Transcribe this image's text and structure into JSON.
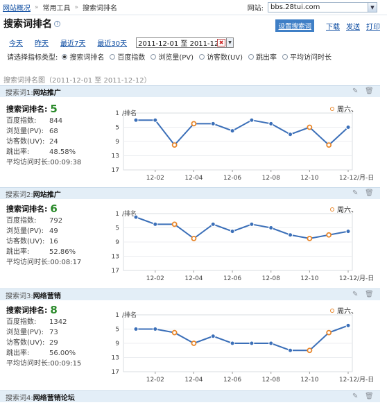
{
  "breadcrumb": {
    "home": "网站概况",
    "tools": "常用工具",
    "current": "搜索词排名"
  },
  "site": {
    "label": "网站:",
    "value": "bbs.28tui.com"
  },
  "page_title": "搜索词排名",
  "actions": {
    "settings": "设置搜索词",
    "download": "下载",
    "send": "发送",
    "print": "打印"
  },
  "date_links": [
    "今天",
    "昨天",
    "最近7天",
    "最近30天"
  ],
  "date_range": "2011-12-01 至 2011-12-12",
  "metric_select": {
    "label": "请选择指标类型:",
    "options": [
      "搜索词排名",
      "百度指数",
      "浏览量(PV)",
      "访客数(UV)",
      "跳出率",
      "平均访问时长"
    ],
    "selected": 0
  },
  "section_title": "搜索词排名图（2011-12-01 至 2011-12-12）",
  "stat_labels": {
    "rank": "搜索词排名:",
    "baidu": "百度指数:",
    "pv": "浏览量(PV):",
    "uv": "访客数(UV):",
    "bounce": "跳出率:",
    "avgtime": "平均访问时长:"
  },
  "keywords": [
    {
      "label": "搜索词1:",
      "name": "网站推广",
      "rank": "5",
      "baidu": "844",
      "pv": "68",
      "uv": "24",
      "bounce": "48.58%",
      "avgtime": "00:09:38"
    },
    {
      "label": "搜索词2:",
      "name": "网站推广",
      "rank": "6",
      "baidu": "792",
      "pv": "49",
      "uv": "16",
      "bounce": "52.86%",
      "avgtime": "00:08:17"
    },
    {
      "label": "搜索词3:",
      "name": "网络营销",
      "rank": "8",
      "baidu": "1342",
      "pv": "73",
      "uv": "29",
      "bounce": "56.00%",
      "avgtime": "00:09:15"
    },
    {
      "label": "搜索词4:",
      "name": "网络营销论坛"
    }
  ],
  "icons": {
    "edit": "pencil-icon",
    "delete": "trash-icon",
    "help": "question-icon",
    "dropdown": "chevron-down-icon"
  },
  "colors": {
    "line": "#3b6fb8",
    "weekend": "#e8862a",
    "rank_value": "#2a8a2a",
    "header_bg": "#e3eef7",
    "button": "#3f7fc6"
  },
  "chart_data": [
    {
      "type": "line",
      "legend": "周六、",
      "ylabel": "/排名",
      "xlabel": "/月-日",
      "y_ticks": [
        "1",
        "5",
        "9",
        "13",
        "17"
      ],
      "ylim": [
        17,
        1
      ],
      "x_ticks": [
        "12-02",
        "12-04",
        "12-06",
        "12-08",
        "12-10",
        "12-12"
      ],
      "x": [
        "12-01",
        "12-02",
        "12-03",
        "12-04",
        "12-05",
        "12-06",
        "12-07",
        "12-08",
        "12-09",
        "12-10",
        "12-11",
        "12-12"
      ],
      "values": [
        3,
        3,
        10,
        4,
        4,
        6,
        3,
        4,
        7,
        5,
        10,
        5
      ],
      "weekend": [
        false,
        false,
        true,
        true,
        false,
        false,
        false,
        false,
        false,
        true,
        true,
        false
      ]
    },
    {
      "type": "line",
      "legend": "周六、",
      "ylabel": "/排名",
      "xlabel": "/月-日",
      "y_ticks": [
        "1",
        "5",
        "9",
        "13",
        "17"
      ],
      "ylim": [
        17,
        1
      ],
      "x_ticks": [
        "12-02",
        "12-04",
        "12-06",
        "12-08",
        "12-10",
        "12-12"
      ],
      "x": [
        "12-01",
        "12-02",
        "12-03",
        "12-04",
        "12-05",
        "12-06",
        "12-07",
        "12-08",
        "12-09",
        "12-10",
        "12-11",
        "12-12"
      ],
      "values": [
        2,
        4,
        4,
        8,
        4,
        6,
        4,
        5,
        7,
        8,
        7,
        6
      ],
      "weekend": [
        false,
        false,
        true,
        true,
        false,
        false,
        false,
        false,
        false,
        true,
        true,
        false
      ]
    },
    {
      "type": "line",
      "legend": "周六、",
      "ylabel": "/排名",
      "xlabel": "/月-日",
      "y_ticks": [
        "1",
        "5",
        "9",
        "13",
        "17"
      ],
      "ylim": [
        17,
        1
      ],
      "x_ticks": [
        "12-02",
        "12-04",
        "12-06",
        "12-08",
        "12-10",
        "12-12"
      ],
      "x": [
        "12-01",
        "12-02",
        "12-03",
        "12-04",
        "12-05",
        "12-06",
        "12-07",
        "12-08",
        "12-09",
        "12-10",
        "12-11",
        "12-12"
      ],
      "values": [
        5,
        5,
        6,
        9,
        7,
        9,
        9,
        9,
        11,
        11,
        6,
        4
      ],
      "weekend": [
        false,
        false,
        true,
        true,
        false,
        false,
        false,
        false,
        false,
        true,
        true,
        false
      ]
    }
  ]
}
